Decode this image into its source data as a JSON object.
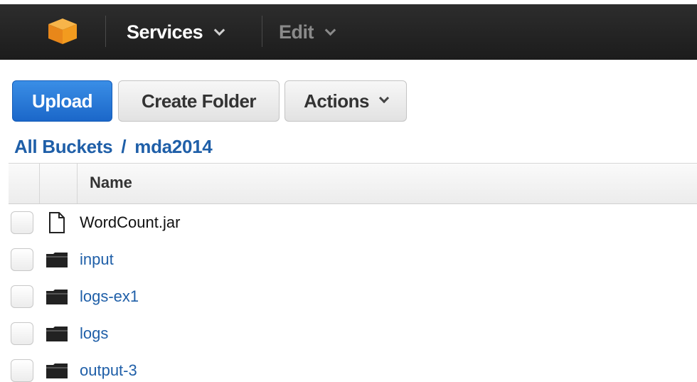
{
  "nav": {
    "logo_icon": "aws-cube-logo-icon",
    "services_label": "Services",
    "edit_label": "Edit",
    "dropdown_icon": "chevron-down-icon"
  },
  "toolbar": {
    "upload_label": "Upload",
    "create_folder_label": "Create Folder",
    "actions_label": "Actions"
  },
  "breadcrumb": {
    "root": "All Buckets",
    "separator": "/",
    "current": "mda2014"
  },
  "table": {
    "columns": [
      "Name"
    ],
    "rows": [
      {
        "name": "WordCount.jar",
        "type": "file",
        "icon": "file-icon"
      },
      {
        "name": "input",
        "type": "folder",
        "icon": "folder-icon"
      },
      {
        "name": "logs-ex1",
        "type": "folder",
        "icon": "folder-icon"
      },
      {
        "name": "logs",
        "type": "folder",
        "icon": "folder-icon"
      },
      {
        "name": "output-3",
        "type": "folder",
        "icon": "folder-icon"
      }
    ]
  },
  "colors": {
    "topbar": "#232323",
    "upload_button": "#2b7bd9",
    "link": "#1f5fa8",
    "logo": "#f29b1f"
  }
}
